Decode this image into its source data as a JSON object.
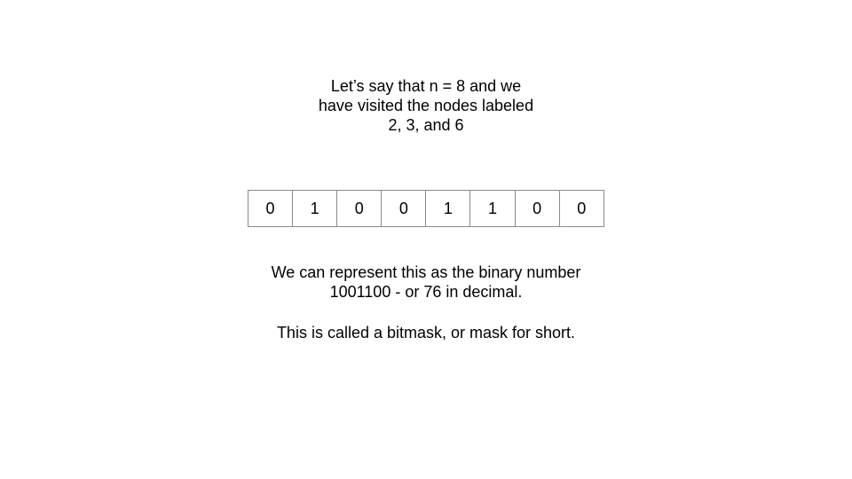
{
  "intro": {
    "lines": [
      "Let’s say that n = 8 and we",
      "have visited the nodes labeled",
      "2, 3, and 6"
    ]
  },
  "bits": [
    "0",
    "1",
    "0",
    "0",
    "1",
    "1",
    "0",
    "0"
  ],
  "explanation": {
    "lines": [
      "We can represent this as the binary number",
      "1001100 - or 76 in decimal."
    ]
  },
  "bitmask_note": "This is called a bitmask, or mask for short."
}
